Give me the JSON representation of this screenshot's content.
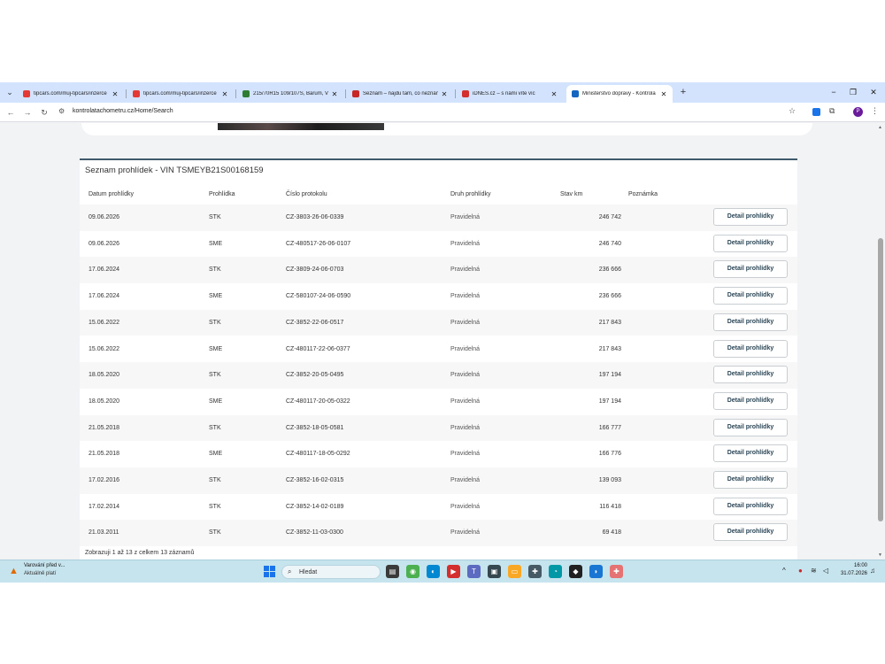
{
  "browser": {
    "tabs": [
      {
        "title": "tipcars.com/muj-tipcars/inzerce",
        "active": false,
        "favicon_color": "#e53935"
      },
      {
        "title": "tipcars.com/muj-tipcars/inzerce",
        "active": false,
        "favicon_color": "#e53935"
      },
      {
        "title": "215/70R15 109/107S, Barum, V",
        "active": false,
        "favicon_color": "#2e7d32"
      },
      {
        "title": "Seznam – najdu tam, co neznám",
        "active": false,
        "favicon_color": "#c62828"
      },
      {
        "title": "iDNES.cz – s námi víte víc",
        "active": false,
        "favicon_color": "#d32f2f"
      },
      {
        "title": "Ministerstvo dopravy - Kontrola",
        "active": true,
        "favicon_color": "#1565c0"
      }
    ],
    "url": "kontrolatachometru.cz/Home/Search"
  },
  "inspections": {
    "title": "Seznam prohlídek - VIN TSMEYB21S00168159",
    "columns": [
      "Datum prohlídky",
      "Prohlídka",
      "Číslo protokolu",
      "Druh prohlídky",
      "Stav km",
      "Poznámka"
    ],
    "detail_label": "Detail prohlídky",
    "rows": [
      {
        "date": "09.06.2026",
        "type": "STK",
        "protocol": "CZ-3803-26-06-0339",
        "kind": "Pravidelná",
        "km": "246 742",
        "note": ""
      },
      {
        "date": "09.06.2026",
        "type": "SME",
        "protocol": "CZ-480517-26-06-0107",
        "kind": "Pravidelná",
        "km": "246 740",
        "note": ""
      },
      {
        "date": "17.06.2024",
        "type": "STK",
        "protocol": "CZ-3809-24-06-0703",
        "kind": "Pravidelná",
        "km": "236 666",
        "note": ""
      },
      {
        "date": "17.06.2024",
        "type": "SME",
        "protocol": "CZ-580107-24-06-0590",
        "kind": "Pravidelná",
        "km": "236 666",
        "note": ""
      },
      {
        "date": "15.06.2022",
        "type": "STK",
        "protocol": "CZ-3852-22-06-0517",
        "kind": "Pravidelná",
        "km": "217 843",
        "note": ""
      },
      {
        "date": "15.06.2022",
        "type": "SME",
        "protocol": "CZ-480117-22-06-0377",
        "kind": "Pravidelná",
        "km": "217 843",
        "note": ""
      },
      {
        "date": "18.05.2020",
        "type": "STK",
        "protocol": "CZ-3852-20-05-0495",
        "kind": "Pravidelná",
        "km": "197 194",
        "note": ""
      },
      {
        "date": "18.05.2020",
        "type": "SME",
        "protocol": "CZ-480117-20-05-0322",
        "kind": "Pravidelná",
        "km": "197 194",
        "note": ""
      },
      {
        "date": "21.05.2018",
        "type": "STK",
        "protocol": "CZ-3852-18-05-0581",
        "kind": "Pravidelná",
        "km": "166 777",
        "note": ""
      },
      {
        "date": "21.05.2018",
        "type": "SME",
        "protocol": "CZ-480117-18-05-0292",
        "kind": "Pravidelná",
        "km": "166 776",
        "note": ""
      },
      {
        "date": "17.02.2016",
        "type": "STK",
        "protocol": "CZ-3852-16-02-0315",
        "kind": "Pravidelná",
        "km": "139 093",
        "note": ""
      },
      {
        "date": "17.02.2014",
        "type": "STK",
        "protocol": "CZ-3852-14-02-0189",
        "kind": "Pravidelná",
        "km": "116 418",
        "note": ""
      },
      {
        "date": "21.03.2011",
        "type": "STK",
        "protocol": "CZ-3852-11-03-0300",
        "kind": "Pravidelná",
        "km": "69 418",
        "note": ""
      }
    ],
    "footer": "Zobrazuji 1 až 13 z celkem 13 záznamů"
  },
  "taskbar": {
    "notice_title": "Varování před v...",
    "notice_sub": "Aktuálně platí",
    "search_placeholder": "Hledat",
    "time": "16:00",
    "date": "31.07.2026"
  }
}
